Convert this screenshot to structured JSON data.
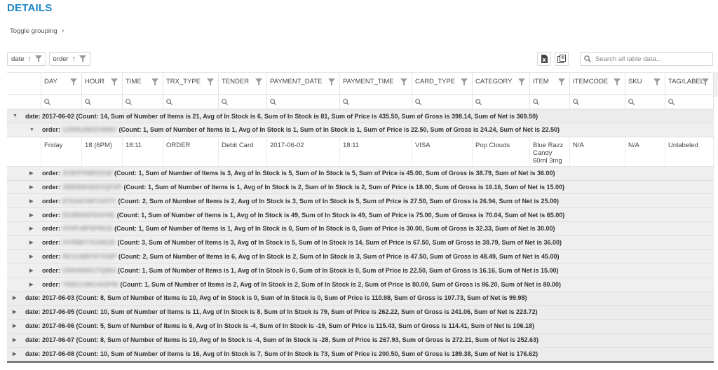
{
  "page": {
    "title": "DETAILS",
    "toggle_grouping": "Toggle grouping"
  },
  "grouping_chips": [
    {
      "label": "date",
      "sort": "↑"
    },
    {
      "label": "order",
      "sort": "↑"
    }
  ],
  "search": {
    "placeholder": "Search all table data..."
  },
  "colors": {
    "title": "#1e88c7",
    "group_bg": "#ececec"
  },
  "columns": [
    "DAY",
    "HOUR",
    "TIME",
    "TRX_TYPE",
    "TENDER",
    "PAYMENT_DATE",
    "PAYMENT_TIME",
    "CARD_TYPE",
    "CATEGORY",
    "ITEM",
    "ITEMCODE",
    "SKU",
    "TAG/LABEL"
  ],
  "groups": {
    "first_date": {
      "label": "date: 2017-06-02 (Count: 14, Sum of Number of Items is 21, Avg of In Stock is 6, Sum of In Stock is 81, Sum of Price is 435.50, Sum of Gross is 398.14, Sum of Net is 369.50)"
    },
    "first_order": {
      "prefix": "order:",
      "id": "1Z90NJNKEVBMC",
      "summary": "(Count: 1, Sum of Number of Items is 1, Avg of In Stock is 1, Sum of In Stock is 1, Sum of Price is 22.50, Sum of Gross is 24.24, Sum of Net is 22.50)"
    },
    "detail_row": {
      "day": "Friday",
      "hour": "18 (6PM)",
      "time": "18:11",
      "trx_type": "ORDER",
      "tender": "Debit Card",
      "payment_date": "2017-06-02",
      "payment_time": "18:11",
      "card_type": "VISA",
      "category": "Pop Clouds",
      "item": "Blue Razz Candy 60ml 3mg",
      "itemcode": "N/A",
      "sku": "N/A",
      "tag": "Unlabeled"
    },
    "orders": [
      {
        "prefix": "order:",
        "id": "3CM7F0NR331W",
        "summary": "(Count: 1, Sum of Number of Items is 3, Avg of In Stock is 5, Sum of In Stock is 5, Sum of Price is 45.00, Sum of Gross is 38.79, Sum of Net is 36.00)"
      },
      {
        "prefix": "order:",
        "id": "3WEBWOKEVQFXP",
        "summary": "(Count: 1, Sum of Number of Items is 1, Avg of In Stock is 2, Sum of In Stock is 2, Sum of Price is 18.00, Sum of Gross is 16.16, Sum of Net is 15.00)"
      },
      {
        "prefix": "order:",
        "id": "D7EA6YNFCK0TY",
        "summary": "(Count: 2, Sum of Number of Items is 2, Avg of In Stock is 3, Sum of In Stock is 5, Sum of Price is 27.50, Sum of Gross is 26.94, Sum of Net is 25.00)"
      },
      {
        "prefix": "order:",
        "id": "E5JB50AFEAYHE",
        "summary": "(Count: 1, Sum of Number of Items is 1, Avg of In Stock is 49, Sum of In Stock is 49, Sum of Price is 75.00, Sum of Gross is 70.04, Sum of Net is 65.00)"
      },
      {
        "prefix": "order:",
        "id": "HT0PJ8PSP9018",
        "summary": "(Count: 1, Sum of Number of Items is 1, Avg of In Stock is 0, Sum of In Stock is 0, Sum of Price is 30.00, Sum of Gross is 32.33, Sum of Net is 30.00)"
      },
      {
        "prefix": "order:",
        "id": "HYR8BYTKX83JE",
        "summary": "(Count: 3, Sum of Number of Items is 3, Avg of In Stock is 5, Sum of In Stock is 14, Sum of Price is 67.50, Sum of Gross is 38.79, Sum of Net is 36.00)"
      },
      {
        "prefix": "order:",
        "id": "RK1C6BPXFYD9P",
        "summary": "(Count: 2, Sum of Number of Items is 6, Avg of In Stock is 2, Sum of In Stock is 3, Sum of Price is 47.50, Sum of Gross is 48.49, Sum of Net is 45.00)"
      },
      {
        "prefix": "order:",
        "id": "V8AHNN0CTQ964",
        "summary": "(Count: 1, Sum of Number of Items is 1, Avg of In Stock is 0, Sum of In Stock is 0, Sum of Price is 22.50, Sum of Gross is 16.16, Sum of Net is 15.00)"
      },
      {
        "prefix": "order:",
        "id": "YEB2JJWCA52PW",
        "summary": "(Count: 1, Sum of Number of Items is 2, Avg of In Stock is 2, Sum of In Stock is 2, Sum of Price is 80.00, Sum of Gross is 86.20, Sum of Net is 80.00)"
      }
    ],
    "dates": [
      {
        "label": "date: 2017-06-03 (Count: 8, Sum of Number of Items is 10, Avg of In Stock is 0, Sum of In Stock is 0, Sum of Price is 110.98, Sum of Gross is 107.73, Sum of Net is 99.98)"
      },
      {
        "label": "date: 2017-06-05 (Count: 10, Sum of Number of Items is 11, Avg of In Stock is 8, Sum of In Stock is 79, Sum of Price is 262.22, Sum of Gross is 241.06, Sum of Net is 223.72)"
      },
      {
        "label": "date: 2017-06-06 (Count: 5, Sum of Number of Items is 6, Avg of In Stock is -4, Sum of In Stock is -19, Sum of Price is 115.43, Sum of Gross is 114.41, Sum of Net is 106.18)"
      },
      {
        "label": "date: 2017-06-07 (Count: 8, Sum of Number of Items is 10, Avg of In Stock is -4, Sum of In Stock is -28, Sum of Price is 267.93, Sum of Gross is 272.21, Sum of Net is 252.63)"
      },
      {
        "label": "date: 2017-06-08 (Count: 10, Sum of Number of Items is 16, Avg of In Stock is 7, Sum of In Stock is 73, Sum of Price is 200.50, Sum of Gross is 189.38, Sum of Net is 176.62)"
      }
    ]
  }
}
